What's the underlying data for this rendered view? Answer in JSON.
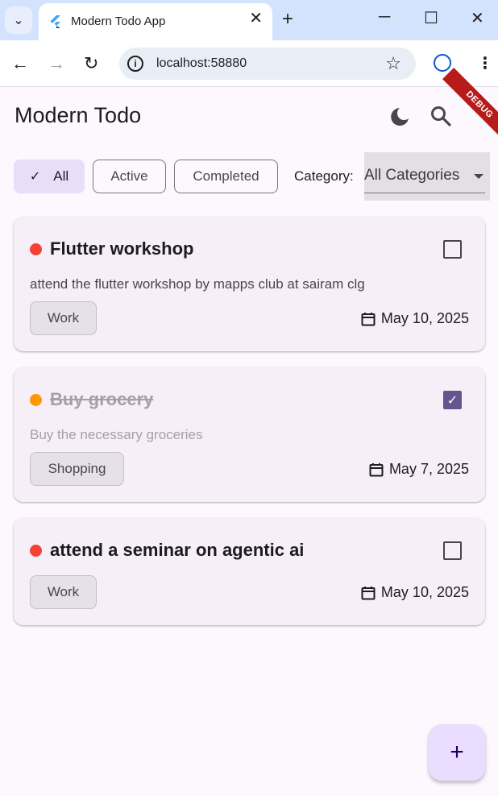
{
  "browser": {
    "tab_title": "Modern Todo App",
    "url": "localhost:58880"
  },
  "app": {
    "title": "Modern Todo",
    "debug_banner": "DEBUG"
  },
  "filters": {
    "chips": [
      {
        "label": "All",
        "selected": true
      },
      {
        "label": "Active",
        "selected": false
      },
      {
        "label": "Completed",
        "selected": false
      }
    ],
    "category_label": "Category:",
    "category_value": "All Categories"
  },
  "todos": [
    {
      "title": "Flutter workshop",
      "description": "attend the flutter workshop by mapps club at sairam clg",
      "category": "Work",
      "date": "May 10, 2025",
      "completed": false,
      "priority_color": "#f44336"
    },
    {
      "title": "Buy grocery",
      "description": "Buy the necessary groceries",
      "category": "Shopping",
      "date": "May 7, 2025",
      "completed": true,
      "priority_color": "#ff9800"
    },
    {
      "title": "attend a seminar on agentic ai",
      "description": "",
      "category": "Work",
      "date": "May 10, 2025",
      "completed": false,
      "priority_color": "#f44336"
    }
  ],
  "colors": {
    "primary_container": "#e8def8",
    "checkbox_checked": "#65558f",
    "fab": "#eaddff"
  }
}
